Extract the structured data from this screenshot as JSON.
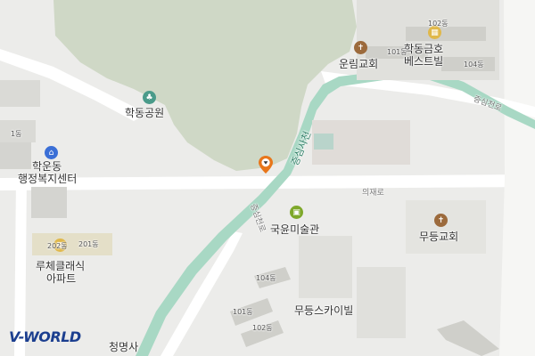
{
  "map": {
    "labels": {
      "hakdong_park": "학동공원",
      "hakun_center_1": "학운동",
      "hakun_center_2": "행정복지센터",
      "lutece_1": "루체클래식",
      "lutece_2": "아파트",
      "gukyun_museum": "국윤미술관",
      "mudeung_skyview": "무등스카이빌",
      "mudeung_church": "무등교회",
      "unrim_church": "운림교회",
      "hakdong_kumho_1": "학동금호",
      "hakdong_kumho_2": "베스트빌",
      "cheongmyeongsa": "청명사",
      "stream_name": "증심사천",
      "stream_road": "증심천로",
      "stream_road_ne": "증심천로",
      "uijae_ro": "의재로"
    },
    "building_numbers": {
      "b102_top": "102동",
      "b101_top": "101동",
      "b104_top": "104동",
      "b1_left": "1동",
      "b202": "202동",
      "b201": "201동",
      "b104_mid": "104동",
      "b101_mid": "101동",
      "b102_mid": "102동"
    },
    "colors": {
      "background": "#ececea",
      "park": "#cfd8c6",
      "stream": "#a8d8c4",
      "road": "#ffffff",
      "building": "#dadad6",
      "accent_church": "#9c6a3c",
      "accent_park": "#4a9b8a",
      "accent_gov": "#3b6fd6",
      "accent_culture": "#7ea82a",
      "pin": "#e8761a"
    },
    "icons": [
      "church-icon",
      "park-icon",
      "government-office-icon",
      "apartment-icon",
      "gallery-icon",
      "location-pin-icon"
    ],
    "logo": "V-WORLD"
  }
}
